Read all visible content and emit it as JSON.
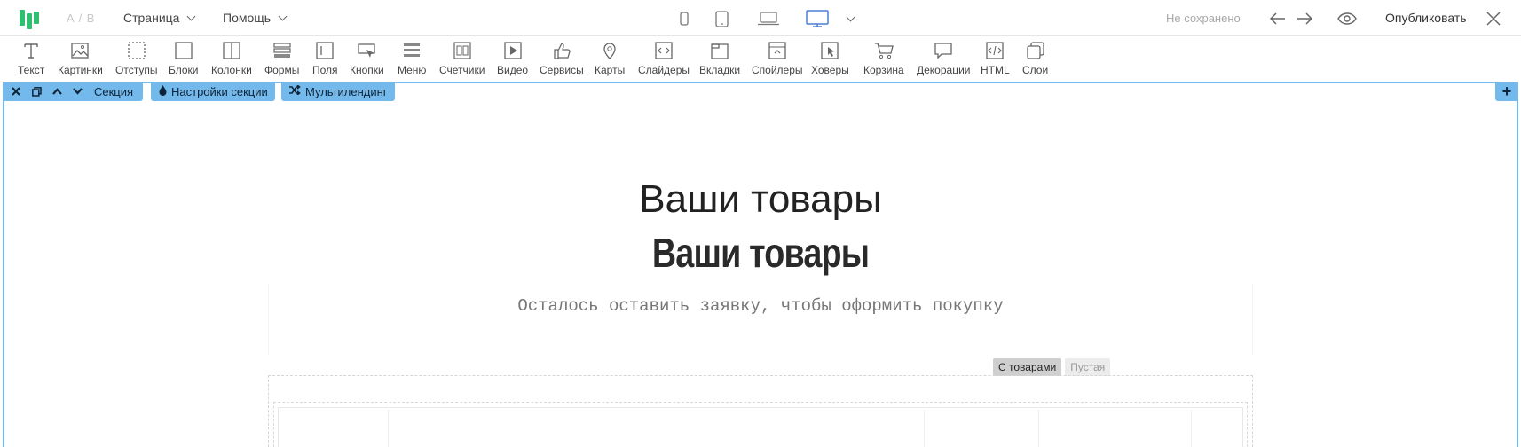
{
  "topbar": {
    "ab_label": "A / B",
    "page_menu": "Страница",
    "help_menu": "Помощь",
    "status": "Не сохранено",
    "publish_label": "Опубликовать",
    "accent_color": "#2fbf71",
    "active_device": "desktop"
  },
  "toolbar": {
    "items": [
      {
        "label": "Текст",
        "icon": "text-icon"
      },
      {
        "label": "Картинки",
        "icon": "image-icon"
      },
      {
        "label": "Отступы",
        "icon": "padding-icon"
      },
      {
        "label": "Блоки",
        "icon": "block-icon"
      },
      {
        "label": "Колонки",
        "icon": "columns-icon"
      },
      {
        "label": "Формы",
        "icon": "form-icon"
      },
      {
        "label": "Поля",
        "icon": "field-icon"
      },
      {
        "label": "Кнопки",
        "icon": "button-icon"
      },
      {
        "label": "Меню",
        "icon": "menu-icon"
      },
      {
        "label": "Счетчики",
        "icon": "counter-icon"
      },
      {
        "label": "Видео",
        "icon": "video-icon"
      },
      {
        "label": "Сервисы",
        "icon": "thumbs-up-icon"
      },
      {
        "label": "Карты",
        "icon": "map-pin-icon"
      },
      {
        "label": "Слайдеры",
        "icon": "slider-icon"
      },
      {
        "label": "Вкладки",
        "icon": "tabs-icon"
      },
      {
        "label": "Спойлеры",
        "icon": "spoiler-icon"
      },
      {
        "label": "Ховеры",
        "icon": "hover-icon"
      },
      {
        "label": "Корзина",
        "icon": "cart-icon"
      },
      {
        "label": "Декорации",
        "icon": "decoration-icon"
      },
      {
        "label": "HTML",
        "icon": "code-icon"
      },
      {
        "label": "Слои",
        "icon": "layers-icon"
      }
    ]
  },
  "section_bar": {
    "section_label": "Секция",
    "settings_label": "Настройки секции",
    "multilanding_label": "Мультилендинг",
    "chip_color": "#74b9ec"
  },
  "content": {
    "heading_primary": "Ваши товары",
    "heading_secondary": "Ваши товары",
    "subtitle": "Осталось оставить заявку, чтобы оформить покупку",
    "tab_with_products": "С товарами",
    "tab_empty": "Пустая"
  }
}
